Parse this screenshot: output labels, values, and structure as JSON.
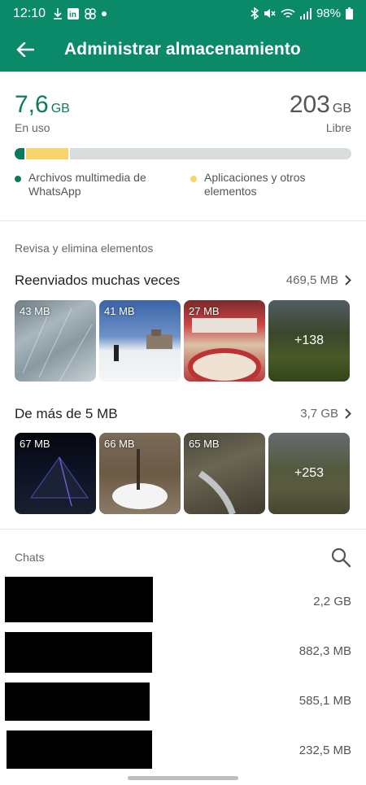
{
  "status_bar": {
    "time": "12:10",
    "left_icons": [
      "download-icon",
      "linkedin-icon",
      "pinwheel-icon",
      "dot-icon"
    ],
    "right_icons": [
      "bluetooth-icon",
      "mute-icon",
      "wifi-icon",
      "signal-icon"
    ],
    "battery": "98%"
  },
  "app_bar": {
    "title": "Administrar almacenamiento"
  },
  "storage": {
    "used_value": "7,6",
    "used_unit": "GB",
    "used_label": "En uso",
    "free_value": "203",
    "free_unit": "GB",
    "free_label": "Libre",
    "whatsapp_fraction": 0.03,
    "apps_fraction": 0.135,
    "legend_whatsapp": "Archivos multimedia de WhatsApp",
    "legend_apps": "Aplicaciones y otros elementos",
    "colors": {
      "whatsapp": "#0b7a5d",
      "apps": "#f7d36b",
      "free": "#d9dcdd"
    }
  },
  "review": {
    "header": "Revisa y elimina elementos",
    "forwarded": {
      "title": "Reenviados muchas veces",
      "size": "469,5 MB",
      "thumbs": [
        {
          "label": "43 MB"
        },
        {
          "label": "41 MB"
        },
        {
          "label": "27 MB"
        },
        {
          "more": "+138"
        }
      ]
    },
    "large": {
      "title": "De más de 5 MB",
      "size": "3,7 GB",
      "thumbs": [
        {
          "label": "67 MB"
        },
        {
          "label": "66 MB"
        },
        {
          "label": "65 MB"
        },
        {
          "more": "+253"
        }
      ]
    }
  },
  "chats": {
    "header": "Chats",
    "rows": [
      {
        "size": "2,2 GB"
      },
      {
        "size": "882,3 MB"
      },
      {
        "size": "585,1 MB"
      },
      {
        "size": "232,5 MB"
      }
    ]
  }
}
